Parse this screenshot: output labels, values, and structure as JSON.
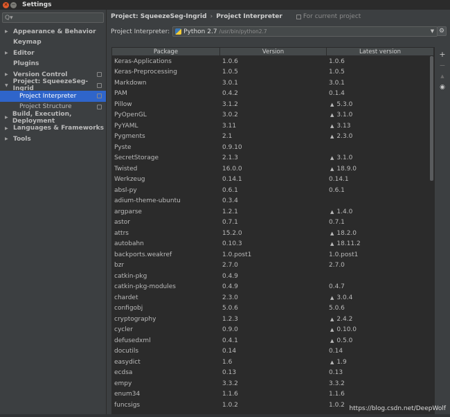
{
  "window": {
    "title": "Settings"
  },
  "sidebar": {
    "search_placeholder": "Q▾",
    "items": [
      {
        "label": "Appearance & Behavior",
        "arrow": "▶",
        "level": 0
      },
      {
        "label": "Keymap",
        "arrow": "",
        "level": 0
      },
      {
        "label": "Editor",
        "arrow": "▶",
        "level": 0
      },
      {
        "label": "Plugins",
        "arrow": "",
        "level": 0
      },
      {
        "label": "Version Control",
        "arrow": "▶",
        "level": 0,
        "icon": "copy-icon"
      },
      {
        "label": "Project: SqueezeSeg-Ingrid",
        "arrow": "▼",
        "level": 0,
        "icon": "copy-icon"
      },
      {
        "label": "Project Interpreter",
        "arrow": "",
        "level": 1,
        "selected": true,
        "icon": "copy-icon"
      },
      {
        "label": "Project Structure",
        "arrow": "",
        "level": 1,
        "icon": "copy-icon"
      },
      {
        "label": "Build, Execution, Deployment",
        "arrow": "▶",
        "level": 0
      },
      {
        "label": "Languages & Frameworks",
        "arrow": "▶",
        "level": 0
      },
      {
        "label": "Tools",
        "arrow": "▶",
        "level": 0
      }
    ]
  },
  "breadcrumb": {
    "project": "Project: SqueezeSeg-Ingrid",
    "separator": "›",
    "page": "Project Interpreter",
    "hint": "For current project"
  },
  "interpreter": {
    "label": "Project Interpreter:",
    "name": "Python 2.7",
    "path": "/usr/bin/python2.7"
  },
  "table": {
    "headers": [
      "Package",
      "Version",
      "Latest version"
    ],
    "rows": [
      {
        "package": "Keras-Applications",
        "version": "1.0.6",
        "latest": "1.0.6",
        "upgrade": false
      },
      {
        "package": "Keras-Preprocessing",
        "version": "1.0.5",
        "latest": "1.0.5",
        "upgrade": false
      },
      {
        "package": "Markdown",
        "version": "3.0.1",
        "latest": "3.0.1",
        "upgrade": false
      },
      {
        "package": "PAM",
        "version": "0.4.2",
        "latest": "0.1.4",
        "upgrade": false
      },
      {
        "package": "Pillow",
        "version": "3.1.2",
        "latest": "5.3.0",
        "upgrade": true
      },
      {
        "package": "PyOpenGL",
        "version": "3.0.2",
        "latest": "3.1.0",
        "upgrade": true
      },
      {
        "package": "PyYAML",
        "version": "3.11",
        "latest": "3.13",
        "upgrade": true
      },
      {
        "package": "Pygments",
        "version": "2.1",
        "latest": "2.3.0",
        "upgrade": true
      },
      {
        "package": "Pyste",
        "version": "0.9.10",
        "latest": "",
        "upgrade": false
      },
      {
        "package": "SecretStorage",
        "version": "2.1.3",
        "latest": "3.1.0",
        "upgrade": true
      },
      {
        "package": "Twisted",
        "version": "16.0.0",
        "latest": "18.9.0",
        "upgrade": true
      },
      {
        "package": "Werkzeug",
        "version": "0.14.1",
        "latest": "0.14.1",
        "upgrade": false
      },
      {
        "package": "absl-py",
        "version": "0.6.1",
        "latest": "0.6.1",
        "upgrade": false
      },
      {
        "package": "adium-theme-ubuntu",
        "version": "0.3.4",
        "latest": "",
        "upgrade": false
      },
      {
        "package": "argparse",
        "version": "1.2.1",
        "latest": "1.4.0",
        "upgrade": true
      },
      {
        "package": "astor",
        "version": "0.7.1",
        "latest": "0.7.1",
        "upgrade": false
      },
      {
        "package": "attrs",
        "version": "15.2.0",
        "latest": "18.2.0",
        "upgrade": true
      },
      {
        "package": "autobahn",
        "version": "0.10.3",
        "latest": "18.11.2",
        "upgrade": true
      },
      {
        "package": "backports.weakref",
        "version": "1.0.post1",
        "latest": "1.0.post1",
        "upgrade": false
      },
      {
        "package": "bzr",
        "version": "2.7.0",
        "latest": "2.7.0",
        "upgrade": false
      },
      {
        "package": "catkin-pkg",
        "version": "0.4.9",
        "latest": "",
        "upgrade": false
      },
      {
        "package": "catkin-pkg-modules",
        "version": "0.4.9",
        "latest": "0.4.7",
        "upgrade": false
      },
      {
        "package": "chardet",
        "version": "2.3.0",
        "latest": "3.0.4",
        "upgrade": true
      },
      {
        "package": "configobj",
        "version": "5.0.6",
        "latest": "5.0.6",
        "upgrade": false
      },
      {
        "package": "cryptography",
        "version": "1.2.3",
        "latest": "2.4.2",
        "upgrade": true
      },
      {
        "package": "cycler",
        "version": "0.9.0",
        "latest": "0.10.0",
        "upgrade": true
      },
      {
        "package": "defusedxml",
        "version": "0.4.1",
        "latest": "0.5.0",
        "upgrade": true
      },
      {
        "package": "docutils",
        "version": "0.14",
        "latest": "0.14",
        "upgrade": false
      },
      {
        "package": "easydict",
        "version": "1.6",
        "latest": "1.9",
        "upgrade": true
      },
      {
        "package": "ecdsa",
        "version": "0.13",
        "latest": "0.13",
        "upgrade": false
      },
      {
        "package": "empy",
        "version": "3.3.2",
        "latest": "3.3.2",
        "upgrade": false
      },
      {
        "package": "enum34",
        "version": "1.1.6",
        "latest": "1.1.6",
        "upgrade": false
      },
      {
        "package": "funcsigs",
        "version": "1.0.2",
        "latest": "1.0.2",
        "upgrade": false
      }
    ]
  },
  "watermark": "https://blog.csdn.net/DeepWolf",
  "toolbar": {
    "add": "+",
    "remove": "−",
    "upgrade": "▲",
    "show_early": "◉"
  }
}
